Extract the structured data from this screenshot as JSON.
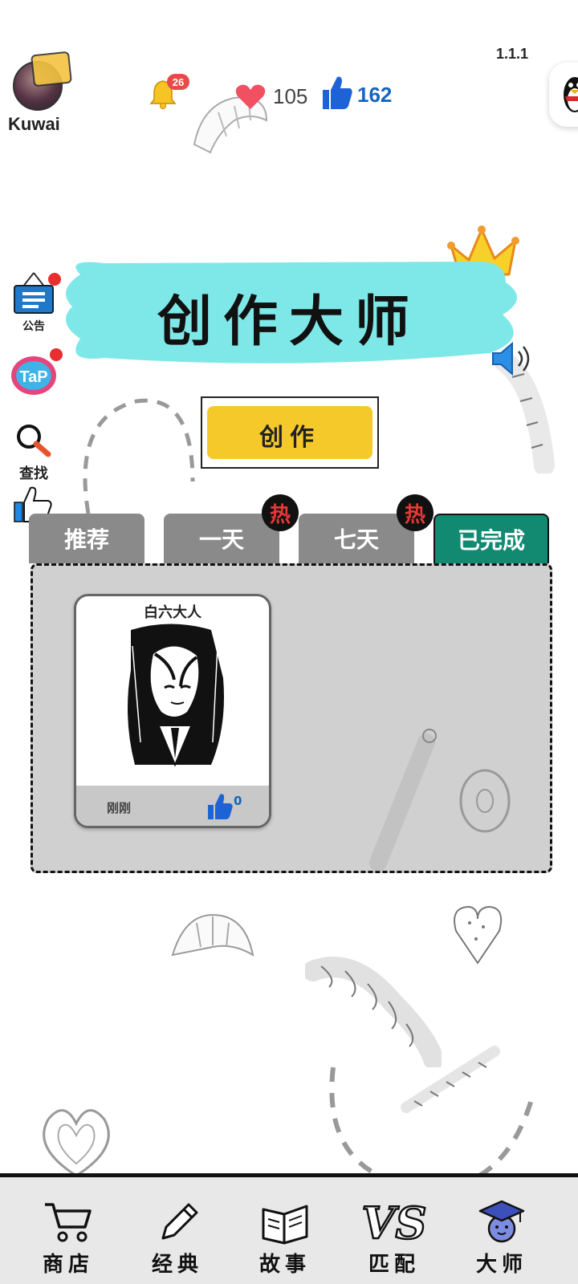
{
  "header": {
    "username": "Kuwai",
    "version": "1.1.1",
    "notifications_count": "26",
    "hearts_count": "105",
    "likes_count": "162"
  },
  "title": "创作大师",
  "sidebar": {
    "items": [
      {
        "label": "公告",
        "icon": "notice-board-icon"
      },
      {
        "label": "",
        "icon": "tap-icon"
      },
      {
        "label": "查找",
        "icon": "magnifier-icon"
      },
      {
        "label": "",
        "icon": "thumbs-up-icon"
      }
    ]
  },
  "create_button": "创作",
  "tabs": [
    {
      "label": "推荐",
      "hot": false,
      "active": false
    },
    {
      "label": "一天",
      "hot": true,
      "active": false
    },
    {
      "label": "七天",
      "hot": true,
      "active": false
    },
    {
      "label": "已完成",
      "hot": false,
      "active": true
    }
  ],
  "hot_badge": "热",
  "cards": [
    {
      "author": "白六大人",
      "time": "刚刚",
      "likes": "0"
    }
  ],
  "bottom_nav": [
    {
      "label": "商店",
      "icon": "cart-icon"
    },
    {
      "label": "经典",
      "icon": "pencil-icon"
    },
    {
      "label": "故事",
      "icon": "book-icon"
    },
    {
      "label": "匹配",
      "icon": "vs-icon"
    },
    {
      "label": "大师",
      "icon": "graduation-cap-icon"
    }
  ],
  "colors": {
    "accent_teal": "#128a72",
    "tab_gray": "#8a8a8a",
    "title_cyan": "#7ee8e8",
    "create_yellow": "#f6c92b",
    "like_blue": "#1565c0",
    "heart_red": "#f05060"
  }
}
